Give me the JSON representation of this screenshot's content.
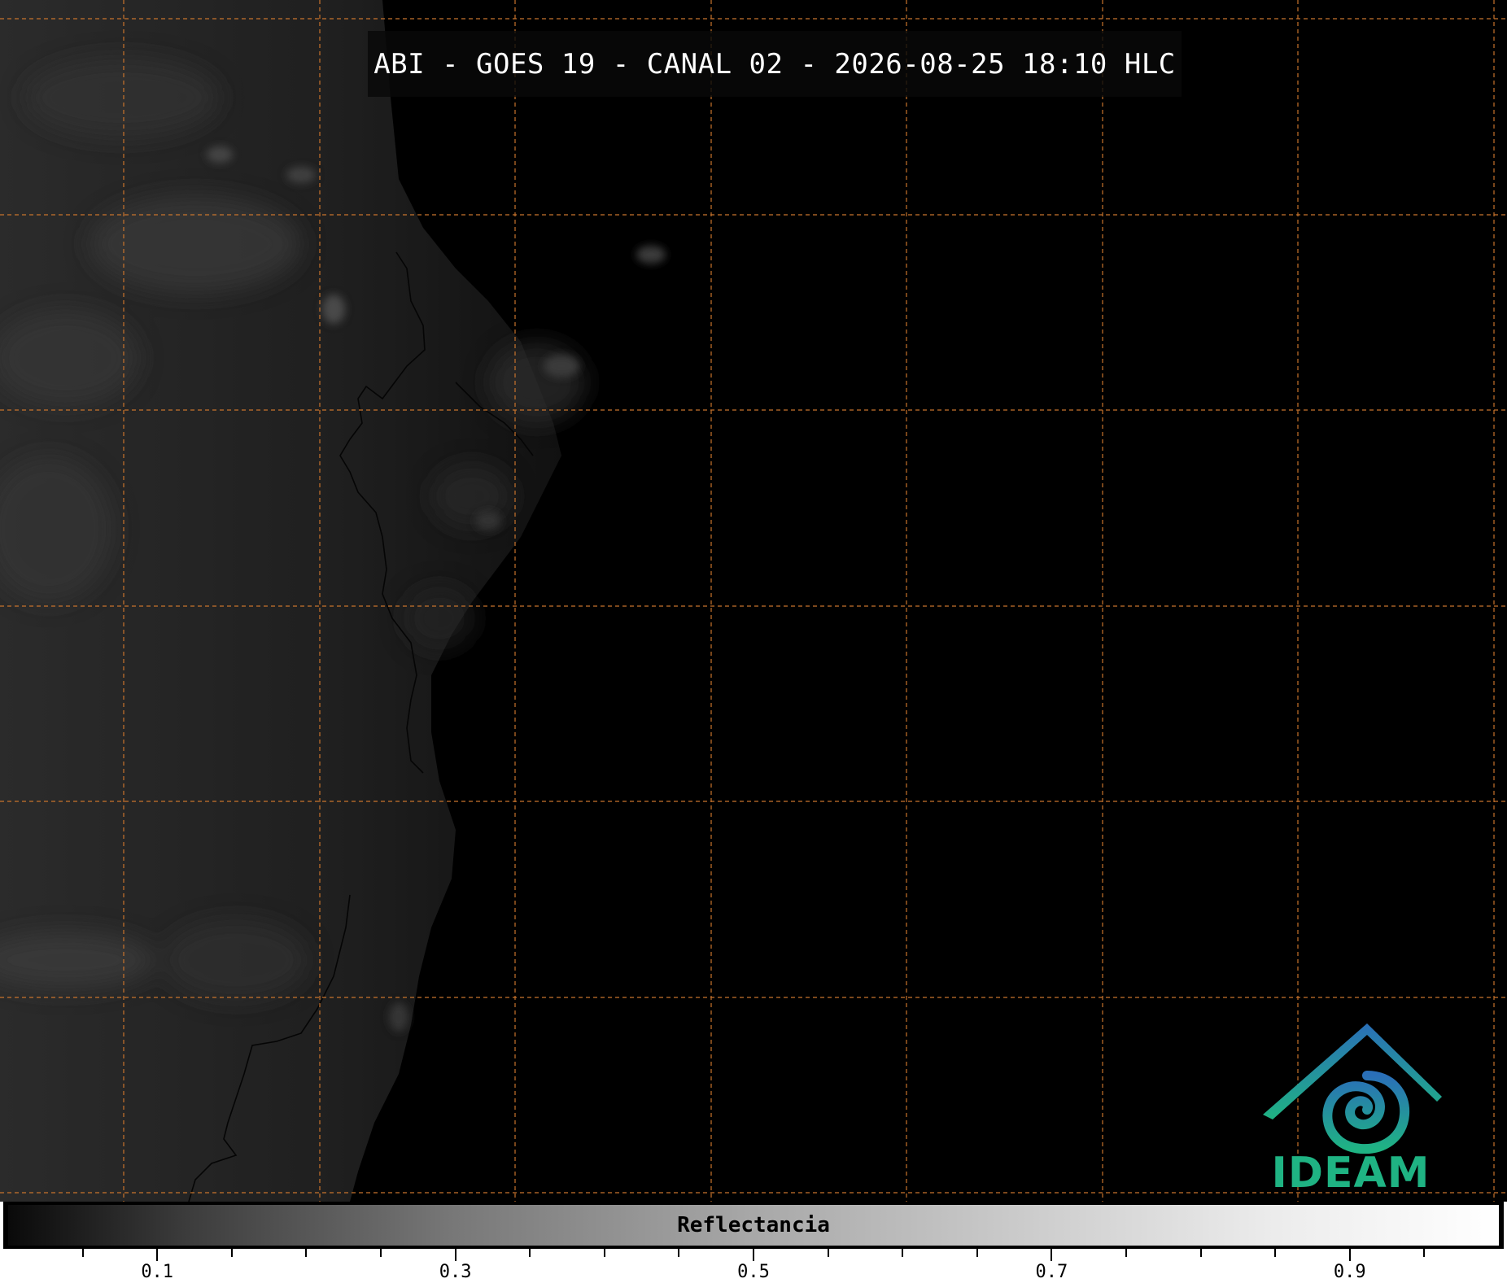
{
  "title": "ABI - GOES 19 - CANAL 02 - 2026-08-25 18:10 HLC",
  "map": {
    "background_color": "#000000",
    "gridline_color": "#c8732c",
    "coastline_color": "#050505",
    "gridline_style": "dashed"
  },
  "logo": {
    "text": "IDEAM",
    "icon": "ideam-spiral-roof-icon",
    "text_color": "#1fb383",
    "roof_color": "#2a6fb8",
    "spiral_color": "#1da79c"
  },
  "colorbar": {
    "label": "Reflectancia",
    "range": [
      0.0,
      1.0
    ],
    "colormap": "grayscale",
    "major_ticks": [
      {
        "value": 0.1,
        "label": "0.1"
      },
      {
        "value": 0.3,
        "label": "0.3"
      },
      {
        "value": 0.5,
        "label": "0.5"
      },
      {
        "value": 0.7,
        "label": "0.7"
      },
      {
        "value": 0.9,
        "label": "0.9"
      }
    ],
    "minor_ticks": [
      0.05,
      0.15,
      0.2,
      0.25,
      0.35,
      0.4,
      0.45,
      0.55,
      0.6,
      0.65,
      0.75,
      0.8,
      0.85,
      0.95
    ]
  }
}
